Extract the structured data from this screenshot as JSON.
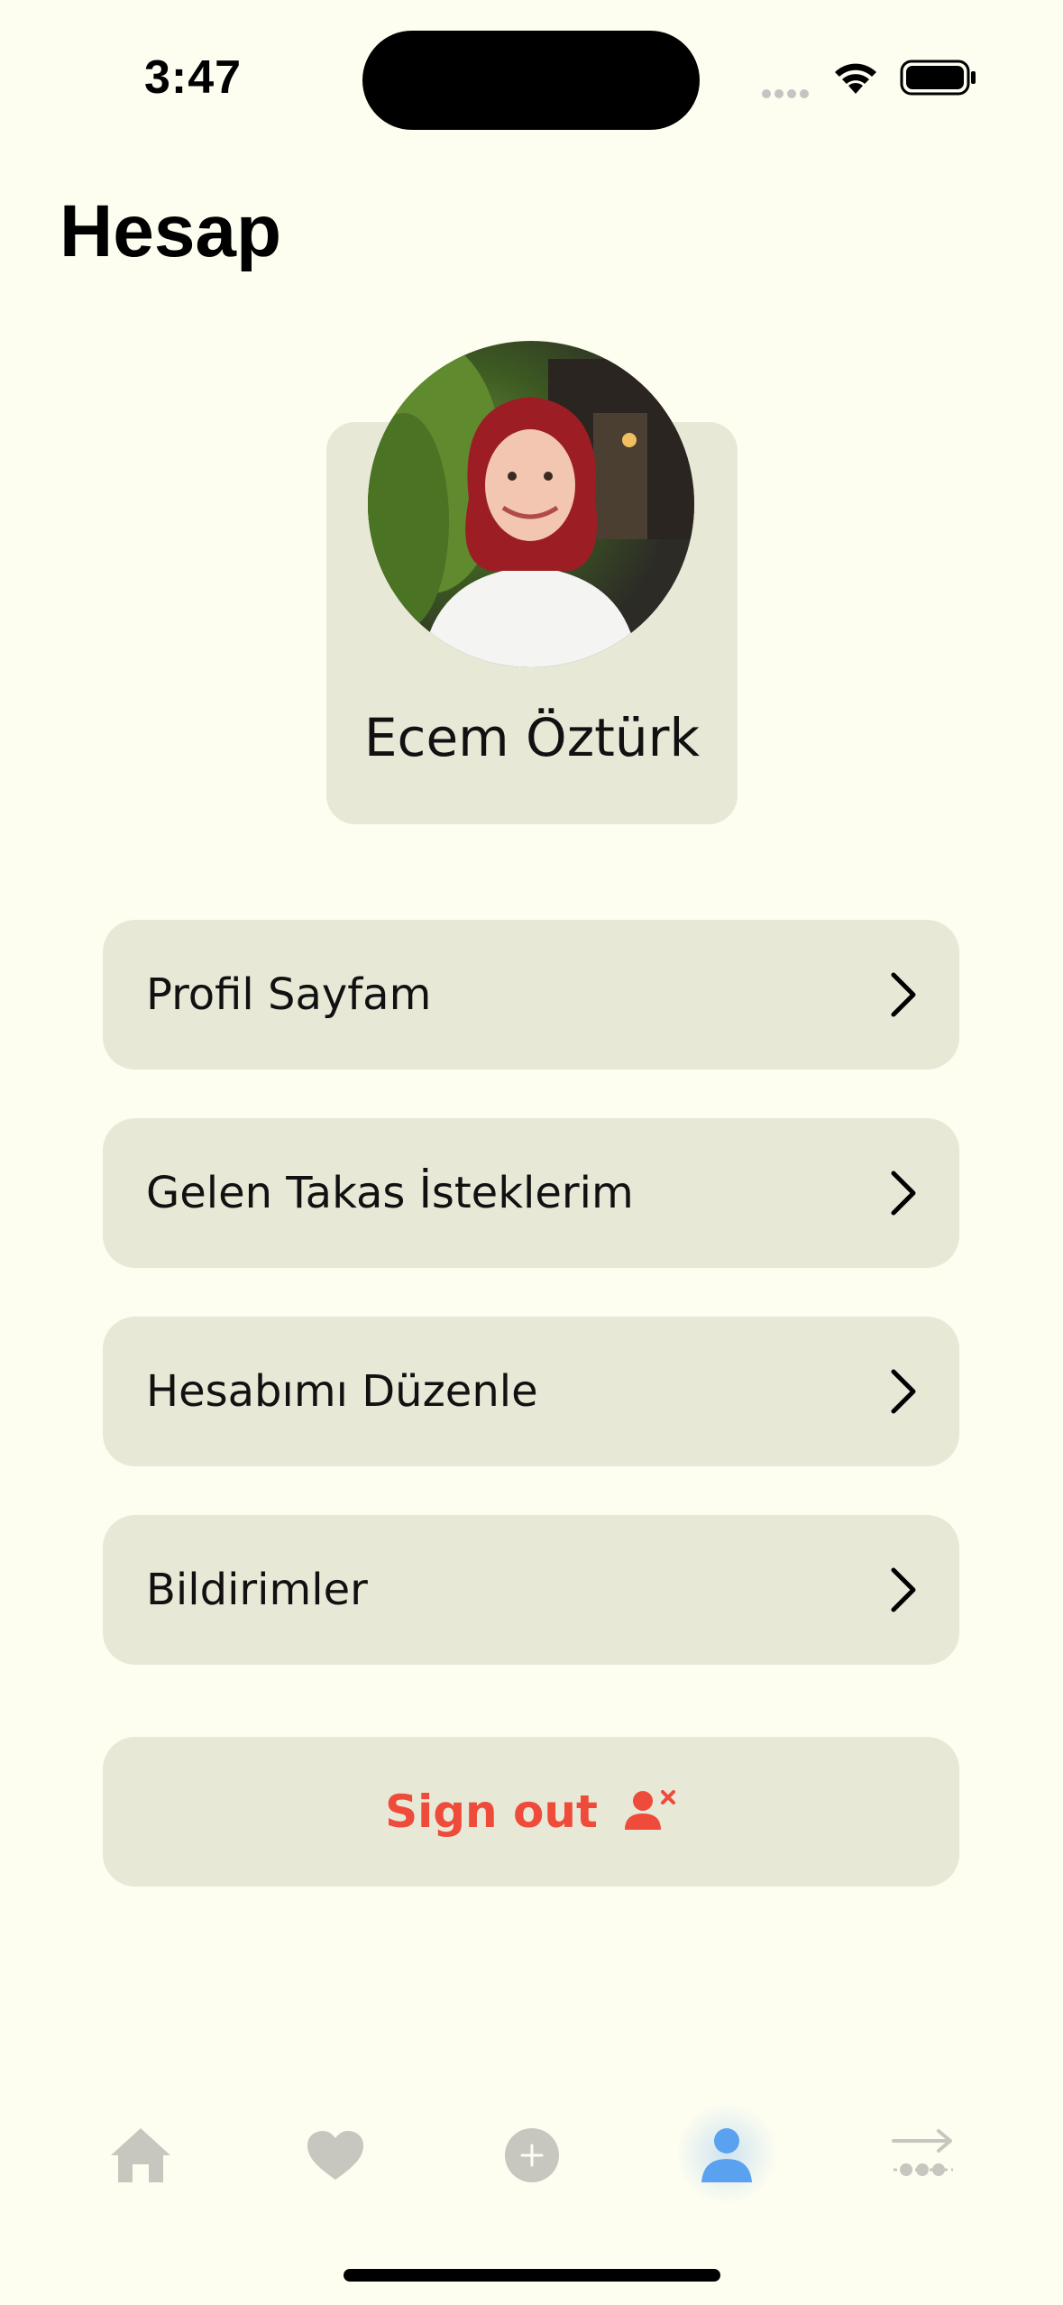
{
  "status_bar": {
    "time": "3:47"
  },
  "header": {
    "title": "Hesap"
  },
  "profile": {
    "name": "Ecem Öztürk"
  },
  "menu": [
    {
      "label": "Profil Sayfam"
    },
    {
      "label": "Gelen Takas İsteklerim"
    },
    {
      "label": "Hesabımı Düzenle"
    },
    {
      "label": "Bildirimler"
    }
  ],
  "signout": {
    "label": "Sign out",
    "color": "#ee4b3b"
  },
  "tabs": [
    {
      "icon": "home-icon"
    },
    {
      "icon": "heart-icon"
    },
    {
      "icon": "add-icon"
    },
    {
      "icon": "person-icon",
      "active": true,
      "color": "#5aa2f0"
    },
    {
      "icon": "swap-icon"
    }
  ],
  "colors": {
    "background": "#fdfdf0",
    "card": "#e8e8d7",
    "inactive_tab": "#c7c7bf"
  }
}
